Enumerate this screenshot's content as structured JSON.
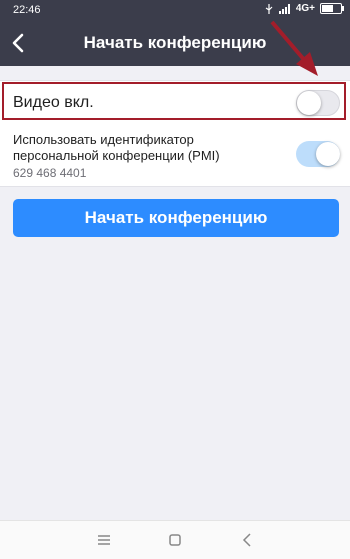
{
  "status_bar": {
    "time": "22:46",
    "network": "4G+",
    "battery_level": 0.6
  },
  "header": {
    "title": "Начать конференцию",
    "back_icon": "chevron-left-icon"
  },
  "video_row": {
    "label": "Видео вкл.",
    "toggle_on": false
  },
  "pmi_row": {
    "label": "Использовать идентификатор персональной конференции (PMI)",
    "pmi_number": "629 468 4401",
    "toggle_on": true
  },
  "start_button": {
    "label": "Начать конференцию"
  },
  "nav_bar": {
    "icons": [
      "menu-icon",
      "home-icon",
      "back-icon"
    ]
  },
  "colors": {
    "header_bg": "#3b3d4b",
    "accent": "#2d8cff",
    "highlight": "#a31d2a",
    "toggle_on": "#bdddfb"
  }
}
